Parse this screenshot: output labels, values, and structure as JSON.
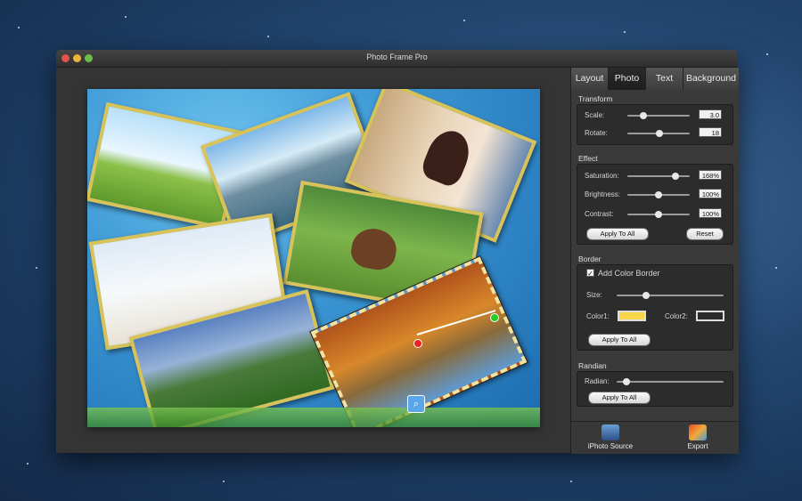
{
  "window": {
    "title": "Photo Frame Pro"
  },
  "tabs": [
    {
      "label": "Layout"
    },
    {
      "label": "Photo"
    },
    {
      "label": "Text"
    },
    {
      "label": "Background"
    }
  ],
  "transform": {
    "title": "Transform",
    "scale_label": "Scale:",
    "scale_value": "3.0",
    "rotate_label": "Rotate:",
    "rotate_value": "18"
  },
  "effect": {
    "title": "Effect",
    "saturation_label": "Saturation:",
    "saturation_value": "168%",
    "brightness_label": "Brightness:",
    "brightness_value": "100%",
    "contrast_label": "Contrast:",
    "contrast_value": "100%",
    "apply_label": "Apply To All",
    "reset_label": "Reset"
  },
  "border": {
    "title": "Border",
    "add_color_border_label": "Add Color Border",
    "add_color_border_checked": true,
    "size_label": "Size:",
    "color1_label": "Color1:",
    "color1": "#f7d64a",
    "color2_label": "Color2:",
    "color2": "#2a2a2a",
    "apply_label": "Apply To All"
  },
  "randian": {
    "title": "Randian",
    "radian_label": "Radian:",
    "apply_label": "Apply To All"
  },
  "bottom": {
    "iphoto_label": "iPhoto Source",
    "export_label": "Export"
  },
  "icons": {
    "zoom": "magnifier-plus-icon",
    "iphoto": "iphoto-icon",
    "export": "export-icon"
  },
  "colors": {
    "accent_handle_start": "#e22222",
    "accent_handle_end": "#22cc22"
  }
}
